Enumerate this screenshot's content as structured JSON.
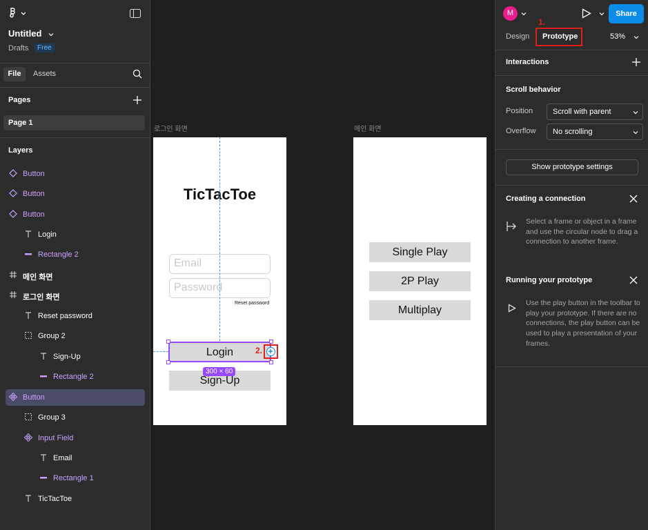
{
  "left": {
    "file_title": "Untitled",
    "drafts_label": "Drafts",
    "plan_badge": "Free",
    "tabs": {
      "file": "File",
      "assets": "Assets"
    },
    "pages_heading": "Pages",
    "current_page": "Page 1",
    "layers_heading": "Layers",
    "layers": [
      {
        "name": "Button",
        "kind": "component-instance"
      },
      {
        "name": "Button",
        "kind": "component-instance"
      },
      {
        "name": "Button",
        "kind": "component-instance"
      },
      {
        "name": "Login",
        "kind": "text"
      },
      {
        "name": "Rectangle 2",
        "kind": "rectangle"
      },
      {
        "name": "메인 화면",
        "kind": "frame"
      },
      {
        "name": "로그인 화면",
        "kind": "frame"
      },
      {
        "name": "Reset password",
        "kind": "text"
      },
      {
        "name": "Group 2",
        "kind": "group"
      },
      {
        "name": "Sign-Up",
        "kind": "text"
      },
      {
        "name": "Rectangle 2",
        "kind": "rectangle"
      },
      {
        "name": "Button",
        "kind": "component",
        "selected": true
      },
      {
        "name": "Group 3",
        "kind": "group"
      },
      {
        "name": "Input Field",
        "kind": "component"
      },
      {
        "name": "Email",
        "kind": "text"
      },
      {
        "name": "Rectangle 1",
        "kind": "rectangle"
      },
      {
        "name": "TicTacToe",
        "kind": "text"
      }
    ]
  },
  "canvas": {
    "login_frame_label": "로그인 화면",
    "main_frame_label": "메인 화면",
    "login": {
      "title": "TicTacToe",
      "email_placeholder": "Email",
      "password_placeholder": "Password",
      "reset_password": "Reset password",
      "login_button": "Login",
      "signup_button": "Sign-Up",
      "size_badge": "300 × 60",
      "annotation_2": "2."
    },
    "main": {
      "single_play": "Single Play",
      "two_p_play": "2P Play",
      "multiplay": "Multiplay"
    }
  },
  "right": {
    "avatar_initial": "M",
    "share_label": "Share",
    "annotation_1": "1.",
    "tabs": {
      "design": "Design",
      "prototype": "Prototype"
    },
    "zoom": "53%",
    "interactions_heading": "Interactions",
    "scroll_behavior_heading": "Scroll behavior",
    "position_label": "Position",
    "position_value": "Scroll with parent",
    "overflow_label": "Overflow",
    "overflow_value": "No scrolling",
    "show_settings_button": "Show prototype settings",
    "creating_connection_heading": "Creating a connection",
    "creating_connection_text": "Select a frame or object in a frame and use the circular node to drag a connection to another frame.",
    "running_prototype_heading": "Running your prototype",
    "running_prototype_text": "Use the play button in the toolbar to play your prototype. If there are no connections, the play button can be used to play a presentation of your frames."
  },
  "colors": {
    "accent_blue": "#0c8ce9",
    "selection_purple": "#9747ff",
    "annotation_red": "#e0201c",
    "avatar_pink": "#e91e8c"
  }
}
